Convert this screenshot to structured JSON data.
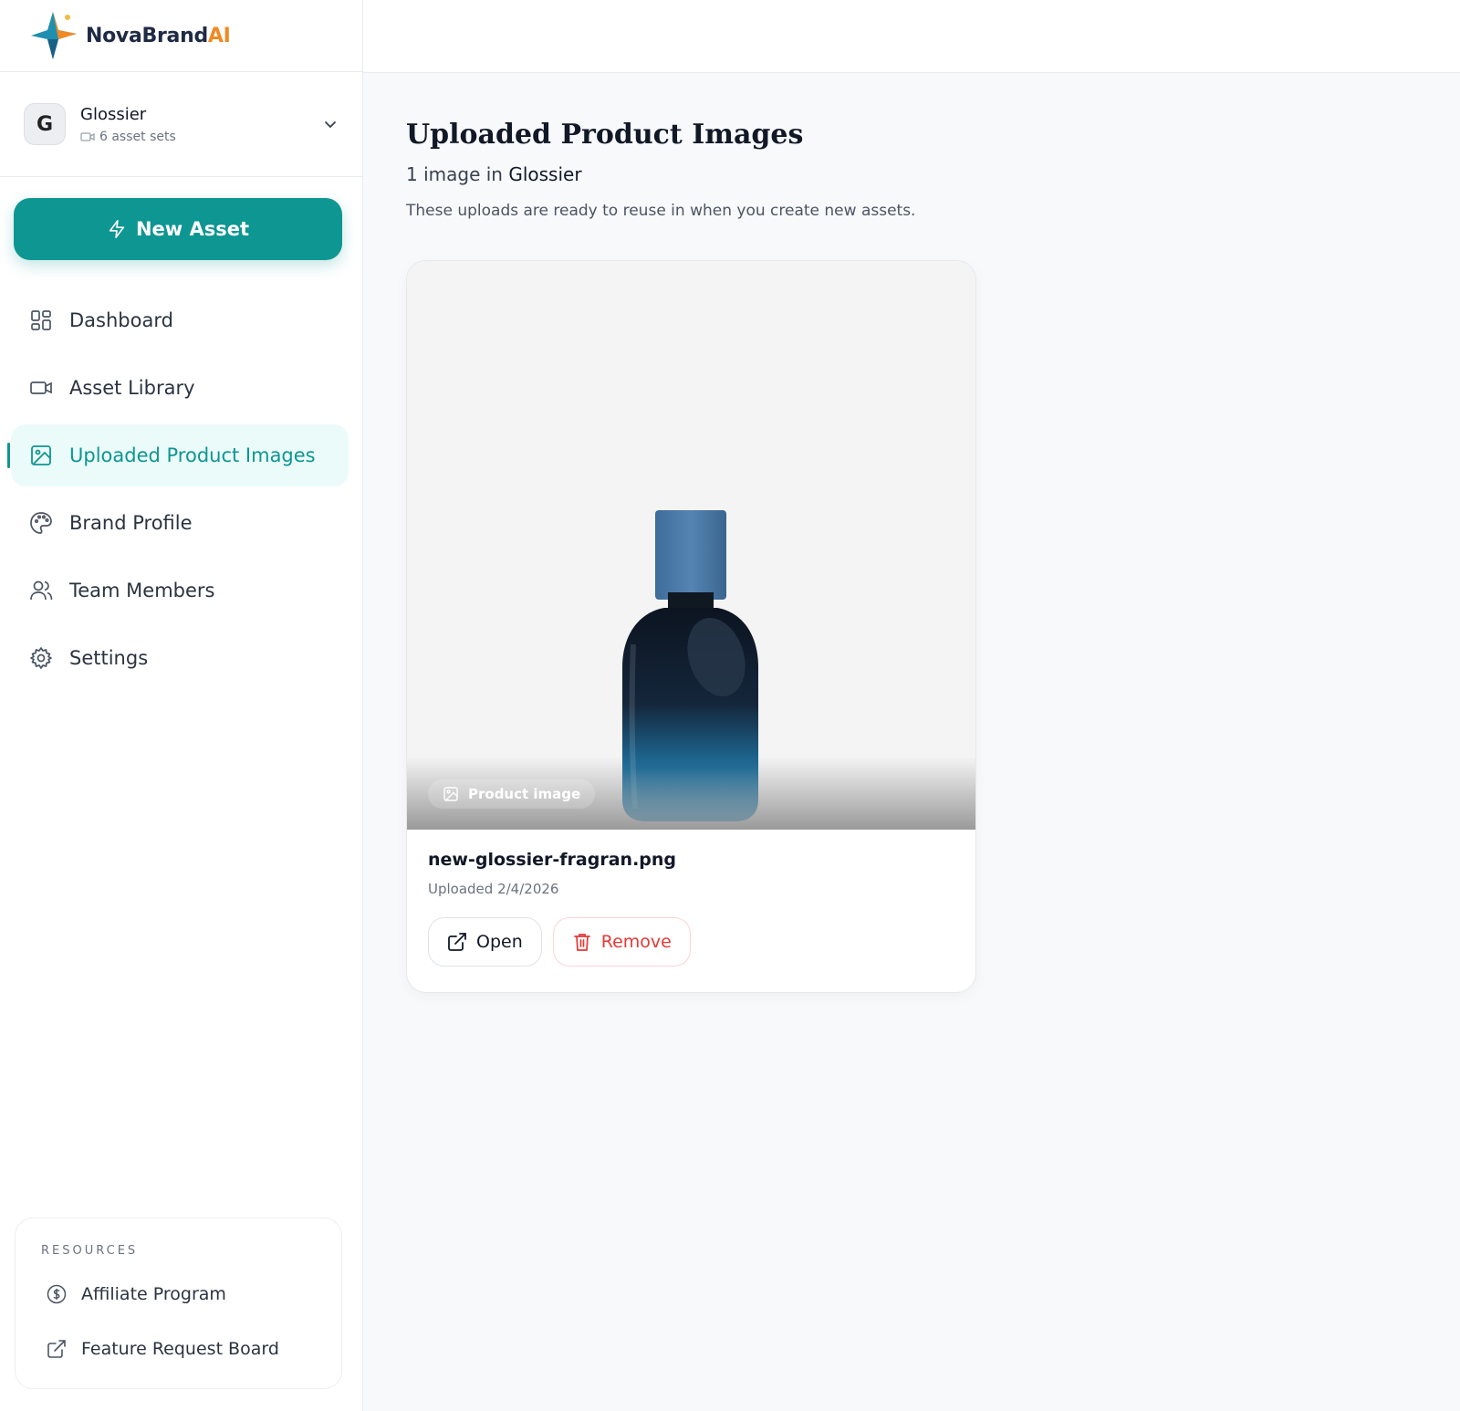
{
  "app": {
    "name_main": "NovaBrand",
    "name_accent": "AI"
  },
  "brand": {
    "name": "Glossier",
    "avatar_letter": "G",
    "asset_sets": "6 asset sets"
  },
  "new_asset_label": "New Asset",
  "nav": [
    {
      "label": "Dashboard",
      "icon": "dashboard-icon"
    },
    {
      "label": "Asset Library",
      "icon": "video-icon"
    },
    {
      "label": "Uploaded Product Images",
      "icon": "image-icon",
      "active": true
    },
    {
      "label": "Brand Profile",
      "icon": "palette-icon"
    },
    {
      "label": "Team Members",
      "icon": "users-icon"
    },
    {
      "label": "Settings",
      "icon": "gear-icon"
    }
  ],
  "resources": {
    "title": "RESOURCES",
    "items": [
      {
        "label": "Affiliate Program",
        "icon": "dollar-circle-icon"
      },
      {
        "label": "Feature Request Board",
        "icon": "external-link-icon"
      }
    ]
  },
  "page": {
    "title": "Uploaded Product Images",
    "count_text": "1 image in",
    "brand_name": "Glossier",
    "description": "These uploads are ready to reuse in when you create new assets."
  },
  "card": {
    "chip_label": "Product image",
    "file_name": "new-glossier-fragran.png",
    "uploaded": "Uploaded 2/4/2026",
    "open_label": "Open",
    "remove_label": "Remove"
  },
  "colors": {
    "accent": "#0e9692",
    "danger": "#e53935",
    "logo_accent": "#f08a24"
  }
}
